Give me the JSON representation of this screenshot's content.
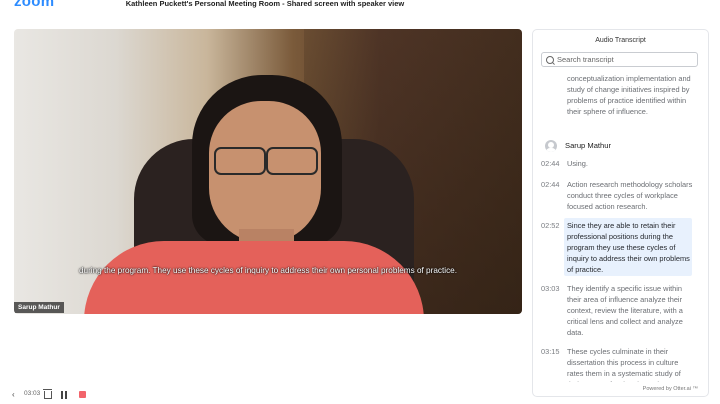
{
  "app": {
    "logo": "zoom",
    "title": "Kathleen Puckett's Personal Meeting Room - Shared screen with speaker view"
  },
  "video": {
    "subtitle": "during the program. They use these cycles of inquiry to address their own personal problems of practice.",
    "participant_name": "Sarup Mathur"
  },
  "transcript": {
    "title": "Audio Transcript",
    "search_placeholder": "Search transcript",
    "intro_text": "conceptualization implementation and study of change initiatives inspired by problems of practice identified within their sphere of influence.",
    "speaker": "Sarup Mathur",
    "entries": [
      {
        "time": "02:44",
        "text": "Using."
      },
      {
        "time": "02:44",
        "text": "Action research methodology scholars conduct three cycles of workplace focused action research."
      },
      {
        "time": "02:52",
        "text": "Since they are able to retain their professional positions during the program they use these cycles of inquiry to address their own problems of practice.",
        "highlighted": true
      },
      {
        "time": "03:03",
        "text": "They identify a specific issue within their area of influence analyze their context, review the literature, with a critical lens and collect and analyze data."
      },
      {
        "time": "03:15",
        "text": "These cycles culminate in their dissertation this process in culture rates them in a systematic study of their own professional practice."
      }
    ],
    "powered_by": "Powered by Otter.ai ™"
  },
  "controls": {
    "back": "‹",
    "time": "03:03"
  }
}
